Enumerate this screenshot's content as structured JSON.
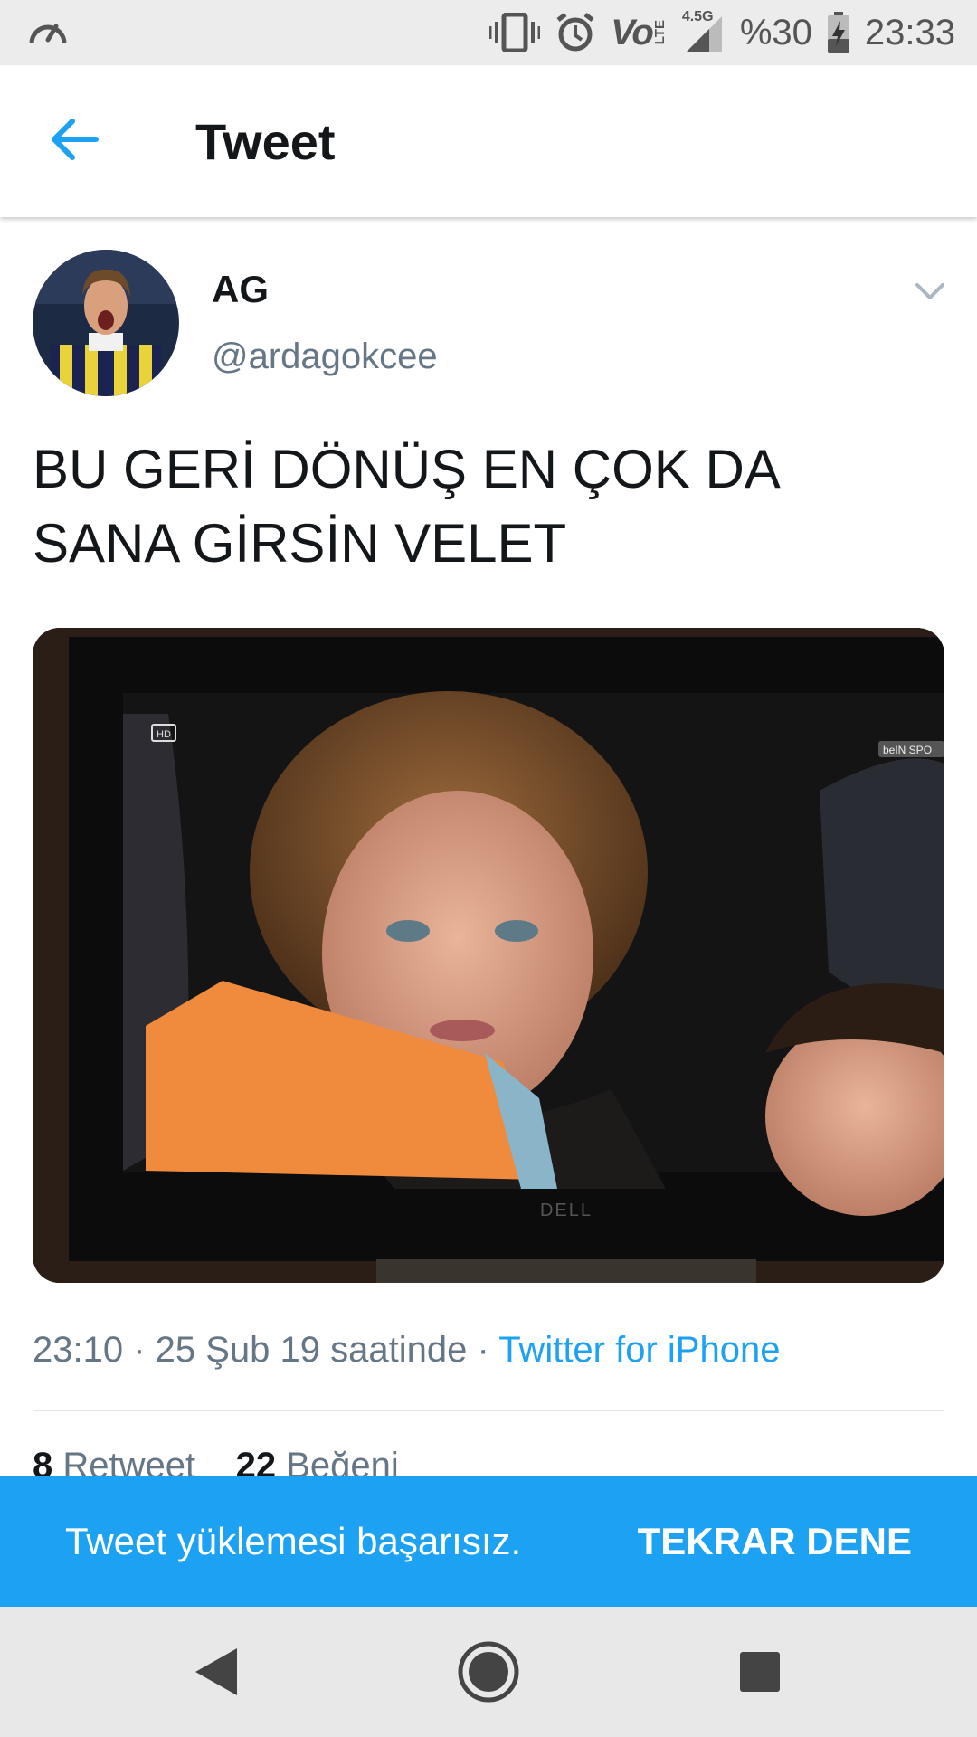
{
  "status_bar": {
    "network": "Vo",
    "network_sub": "LTE",
    "network_gen": "4.5G",
    "battery": "%30",
    "time": "23:33"
  },
  "header": {
    "title": "Tweet"
  },
  "tweet": {
    "display_name": "AG",
    "handle": "@ardagokcee",
    "text_line1": "BU GERİ DÖNÜŞ EN ÇOK DA",
    "text_line2": "SANA GİRSİN VELET",
    "media": {
      "hd_badge": "HD",
      "brand": "DELL",
      "channel": "beIN SPO"
    },
    "timestamp": "23:10 · 25 Şub 19 saatinde · ",
    "source": "Twitter for iPhone",
    "retweet_count": "8",
    "retweet_label": "Retweet",
    "like_count": "22",
    "like_label": "Beğeni"
  },
  "snackbar": {
    "message": "Tweet yüklemesi başarısız.",
    "action": "TEKRAR DENE"
  },
  "colors": {
    "accent": "#1da1f2",
    "text": "#14171a",
    "secondary": "#657786"
  }
}
